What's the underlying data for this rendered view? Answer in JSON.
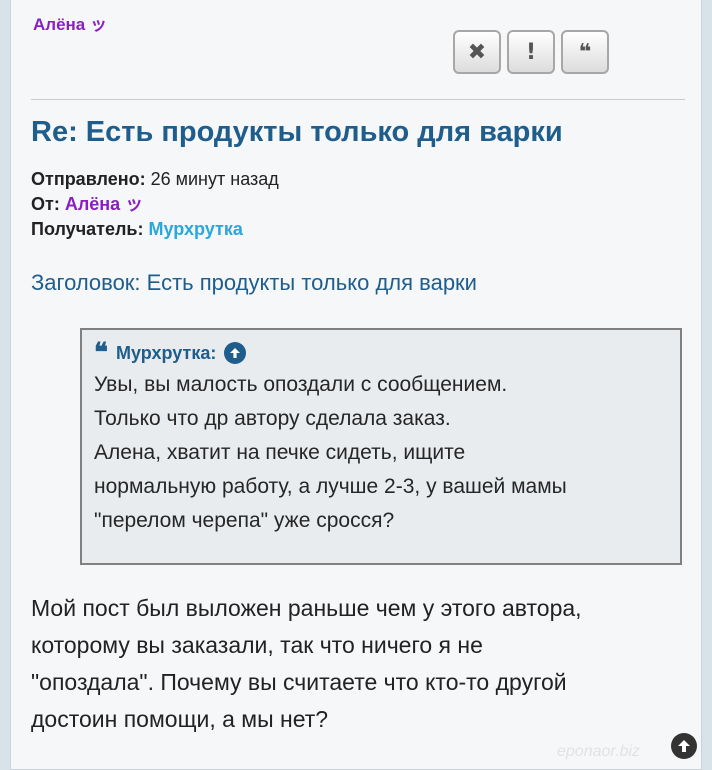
{
  "post": {
    "author": "Алёна ッ",
    "title": "Re: Есть продукты только для варки",
    "meta": {
      "sent_label": "Отправлено:",
      "sent_value": "26 минут назад",
      "from_label": "От:",
      "from_value": "Алёна ッ",
      "to_label": "Получатель:",
      "to_value": "Мурхрутка"
    },
    "subject": "Заголовок: Есть продукты только для варки",
    "quote": {
      "author": "Мурхрутка:",
      "lines": [
        "Увы, вы малость опоздали с сообщением.",
        "Только что др автору сделала заказ.",
        "Алена, хватит на печке сидеть, ищите",
        "нормальную работу, а лучше 2-3, у вашей мамы",
        "\"перелом черепа\" уже сросся?"
      ]
    },
    "body": [
      "Мой пост был выложен раньше чем у этого автора,",
      "которому вы заказали, так что ничего я не",
      "\"опоздала\". Почему вы считаете что кто-то другой",
      "достоин помощи, а мы нет?"
    ]
  },
  "actions": {
    "delete_symbol": "✖",
    "report_symbol": "!",
    "quote_symbol": "❝"
  },
  "watermark": "eponaor.biz",
  "icons": [
    "close-icon",
    "exclamation-icon",
    "quote-icon",
    "arrow-up-circle-icon"
  ],
  "colors": {
    "author": "#8a1fbf",
    "title": "#1e5d8c",
    "recipient": "#28a8dc"
  }
}
